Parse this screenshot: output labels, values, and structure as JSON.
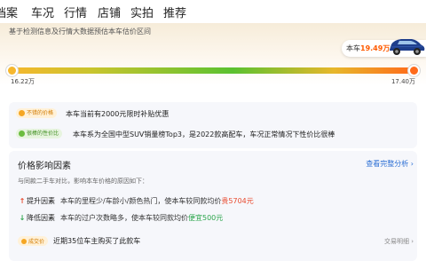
{
  "tabs": [
    {
      "label": "档案",
      "active": false
    },
    {
      "label": "车况",
      "active": false
    },
    {
      "label": "行情",
      "active": true
    },
    {
      "label": "店铺",
      "active": false
    },
    {
      "label": "实拍",
      "active": false
    },
    {
      "label": "推荐",
      "active": false
    }
  ],
  "estimate": {
    "intro": "基于检测信息及行情大数据预估本车估价区间",
    "tag_label": "本车",
    "tag_price": "19.49万",
    "range_min": "16.22万",
    "range_max": "17.40万",
    "car_icon": "suv-car-icon"
  },
  "reasons": [
    {
      "badge": "不错的价格",
      "text": "本车当前有2000元限时补贴优惠",
      "style": "orange"
    },
    {
      "badge": "很棒的性价比",
      "text": "本车系为全国中型SUV销量榜Top3，是2022款高配车，车况正常情况下性价比很棒",
      "style": "green"
    }
  ],
  "factors_section": {
    "title": "价格影响因素",
    "more_link": "查看完整分析 ›",
    "subtitle": "与同款二手车对比，影响本车价格的原因如下：",
    "items": [
      {
        "direction": "up",
        "arrow": "↑",
        "name": "提升因素",
        "text_prefix": "本车的里程少/车龄小/颜色热门，使本车较同款均价",
        "highlight": "贵5704元"
      },
      {
        "direction": "down",
        "arrow": "↓",
        "name": "降低因素",
        "text_prefix": "本车的过户次数略多，使本车较同款均价",
        "highlight": "便宜500元"
      }
    ]
  },
  "deals": {
    "badge": "成交价",
    "text": "近期35位车主购买了此款车",
    "link": "交易明细 ›"
  },
  "colors": {
    "accent": "#ff6a13",
    "price_orange": "#ff5a00",
    "link_blue": "#2c6fd4",
    "up_red": "#e84a2e",
    "down_green": "#2ba54b"
  }
}
